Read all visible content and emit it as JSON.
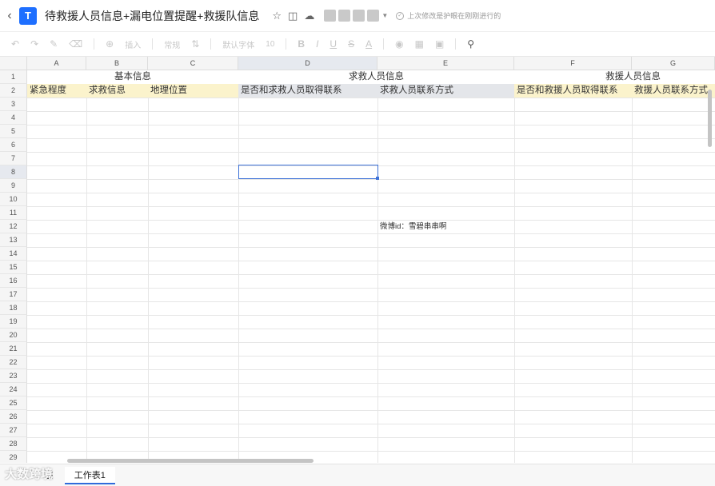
{
  "titlebar": {
    "back_icon": "chevron-left-icon",
    "logo_icon": "tencent-docs-logo-icon",
    "title": "待救援人员信息+漏电位置提醒+救援队信息",
    "save_status": "上次修改是护眼在刚刚进行的"
  },
  "toolbar": {
    "insert_label": "插入",
    "format_label": "常规",
    "font_label": "默认字体",
    "font_size": "10"
  },
  "columns": [
    "A",
    "B",
    "C",
    "D",
    "E",
    "F",
    "G"
  ],
  "rows": [
    "1",
    "2",
    "3",
    "4",
    "5",
    "6",
    "7",
    "8",
    "9",
    "10",
    "11",
    "12",
    "13",
    "14",
    "15",
    "16",
    "17",
    "18",
    "19",
    "20",
    "21",
    "22",
    "23",
    "24",
    "25",
    "26",
    "27",
    "28",
    "29"
  ],
  "sheet": {
    "row1": {
      "basic_info": "基本信息",
      "seeker_info": "求救人员信息",
      "rescuer_info": "救援人员信息"
    },
    "row2": {
      "A": "紧急程度",
      "B": "求救信息",
      "C": "地理位置",
      "D": "是否和求救人员取得联系",
      "E": "求救人员联系方式",
      "F": "是否和救援人员取得联系",
      "G": "救援人员联系方式"
    },
    "E12": "微博id：雪碧串串啊"
  },
  "selected_cell": "D8",
  "sheet_tabs": [
    "工作表1"
  ],
  "watermark": "大数跨境",
  "colors": {
    "header_yellow": "#fbf3cc",
    "header_grey": "#e4e6ea",
    "selection_blue": "#3e72d8"
  }
}
